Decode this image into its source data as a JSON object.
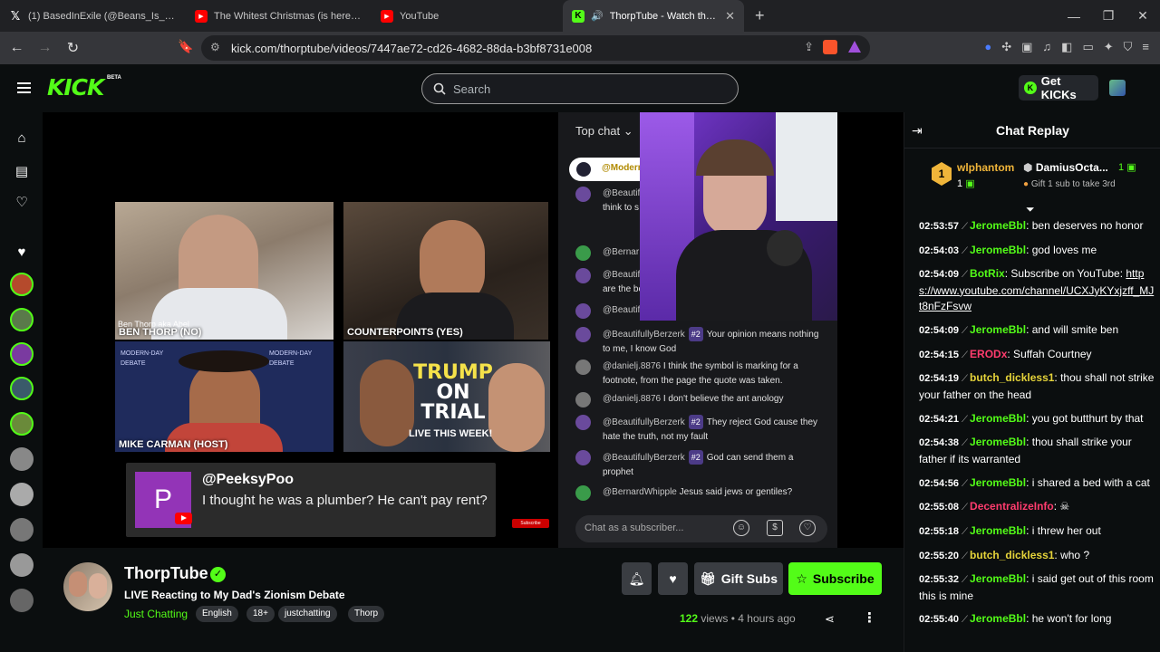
{
  "browser": {
    "tabs": [
      {
        "title": "(1) BasedInExile (@Beans_Is_Baked) /",
        "icon": "x-icon"
      },
      {
        "title": "The Whitest Christmas (is here) - Chr",
        "icon": "youtube-icon"
      },
      {
        "title": "YouTube",
        "icon": "youtube-icon"
      },
      {
        "title": "ThorpTube - Watch the VOD",
        "icon": "kick-icon",
        "active": true
      }
    ],
    "url": "kick.com/thorptube/videos/7447ae72-cd26-4682-88da-b3bf8731e008"
  },
  "header": {
    "logo": "KICK",
    "beta": "BETA",
    "search_placeholder": "Search",
    "get_kicks": "Get KICKs"
  },
  "video": {
    "panels": [
      {
        "label": "BEN THORP (NO)"
      },
      {
        "label": "COUNTERPOINTS (YES)"
      },
      {
        "label": "MIKE CARMAN (HOST)"
      },
      {
        "label": "TRUMP ON TRIAL"
      }
    ],
    "ben_caption": "Ben Thorp aka Abel",
    "tile_text": "MODERN-DAY DEBATE",
    "trump_line1": "TRUMP",
    "trump_line2": "ON",
    "trump_line3": "TRIAL",
    "trump_sub": "LIVE THIS WEEK!",
    "comment": {
      "initial": "P",
      "user": "@PeeksyPoo",
      "text": "I thought he was a plumber? He can't pay rent?"
    },
    "subscribe_tag": "Subscribe",
    "overlay_chat": {
      "top_chat": "Top chat",
      "pinned": "@Moderr",
      "rows": [
        {
          "name": "@Beautif",
          "text": "think to s father.' Fo children t"
        },
        {
          "name": "@Bernar",
          "text": ""
        },
        {
          "name": "@Beautif",
          "text": "are the be"
        },
        {
          "name": "@Beautif",
          "text": ""
        },
        {
          "name": "@BeautifullyBerzerk",
          "badge": "#2",
          "text": "Your opinion means nothing to me, I know God"
        },
        {
          "name": "@danielj.8876",
          "badge": "",
          "text": "I think the symbol is marking for a footnote, from the page the quote was taken."
        },
        {
          "name": "@danielj.8876",
          "badge": "",
          "text": "I don't believe the ant anology"
        },
        {
          "name": "@BeautifullyBerzerk",
          "badge": "#2",
          "text": "They reject God cause they hate the truth, not my fault"
        },
        {
          "name": "@BeautifullyBerzerk",
          "badge": "#2",
          "text": "God can send them a prophet"
        },
        {
          "name": "@BernardWhipple",
          "badge": "",
          "text": "Jesus said jews or gentiles?"
        }
      ],
      "input_placeholder": "Chat as a subscriber..."
    }
  },
  "channel": {
    "name": "ThorpTube",
    "title": "LIVE Reacting to My Dad's Zionism Debate",
    "category": "Just Chatting",
    "tags": [
      "English",
      "18+",
      "justchatting",
      "Thorp"
    ],
    "gift_subs": "Gift Subs",
    "subscribe": "Subscribe",
    "views_count": "122",
    "views_label": "views",
    "dot": "•",
    "age": "4 hours ago"
  },
  "chat": {
    "title": "Chat Replay",
    "pinned": {
      "rank1": "1",
      "user1": "wlphantom",
      "count1": "1",
      "user2": "DamiusOcta...",
      "count2": "1",
      "gift_note": "Gift 1 sub to take 3rd"
    },
    "messages": [
      {
        "time": "02:53:57",
        "user": "JeromeBbl",
        "color": "u-green",
        "text": ": ben deserves no honor"
      },
      {
        "time": "02:54:03",
        "user": "JeromeBbl",
        "color": "u-green",
        "text": ": god loves me"
      },
      {
        "time": "02:54:09",
        "user": "BotRix",
        "color": "u-green",
        "text": ": Subscribe on YouTube: ",
        "link": "https://www.youtube.com/channel/UCXJyKYxjzff_MJt8nFzFsvw"
      },
      {
        "time": "02:54:09",
        "user": "JeromeBbl",
        "color": "u-green",
        "text": ": and will smite ben"
      },
      {
        "time": "02:54:15",
        "user": "ERODx",
        "color": "u-red",
        "text": ": Suffah Courtney"
      },
      {
        "time": "02:54:19",
        "user": "butch_dickless1",
        "color": "u-yellow",
        "text": ": thou shall not strike your father on the head"
      },
      {
        "time": "02:54:21",
        "user": "JeromeBbl",
        "color": "u-green",
        "text": ": you got butthurt by that"
      },
      {
        "time": "02:54:38",
        "user": "JeromeBbl",
        "color": "u-green",
        "text": ": thou shall strike your father if its warranted"
      },
      {
        "time": "02:54:56",
        "user": "JeromeBbl",
        "color": "u-green",
        "text": ": i shared a bed with a cat"
      },
      {
        "time": "02:55:08",
        "user": "DecentralizeInfo",
        "color": "u-red",
        "text": ": ☠"
      },
      {
        "time": "02:55:18",
        "user": "JeromeBbl",
        "color": "u-green",
        "text": ": i threw her out"
      },
      {
        "time": "02:55:20",
        "user": "butch_dickless1",
        "color": "u-yellow",
        "text": ": who ?"
      },
      {
        "time": "02:55:32",
        "user": "JeromeBbl",
        "color": "u-green",
        "text": ": i said get out of this room this is mine"
      },
      {
        "time": "02:55:40",
        "user": "JeromeBbl",
        "color": "u-green",
        "text": ": he won't for long"
      }
    ]
  }
}
